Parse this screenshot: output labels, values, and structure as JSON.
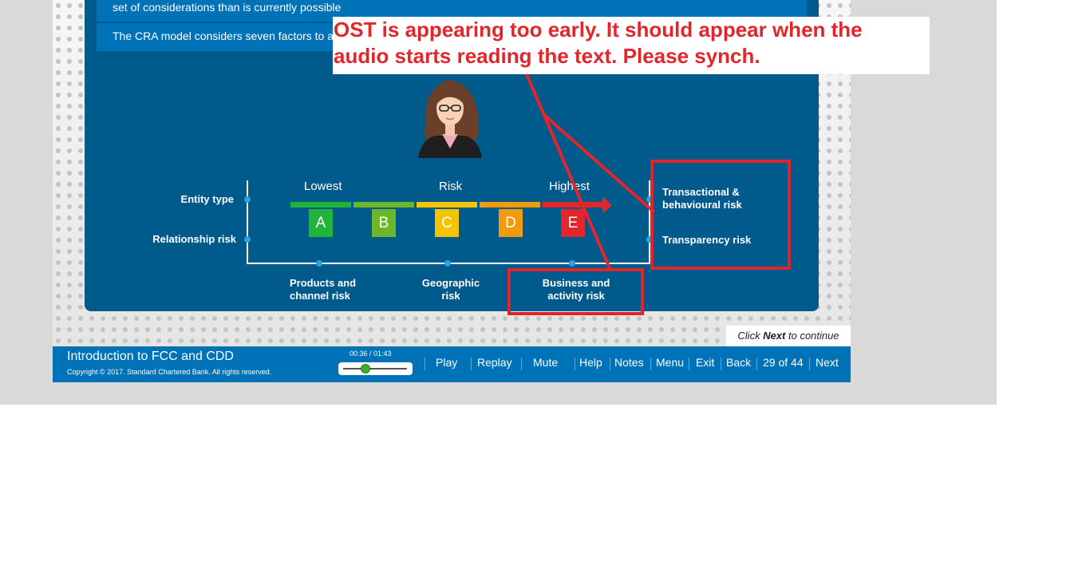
{
  "content": {
    "row1_text": "set of considerations than is currently possible",
    "row2_text": "The CRA model considers seven factors to a",
    "scale": {
      "lowest": "Lowest",
      "risk": "Risk",
      "highest": "Highest"
    },
    "levels": [
      {
        "letter": "A",
        "color": "#21b43a"
      },
      {
        "letter": "B",
        "color": "#6cb62a"
      },
      {
        "letter": "C",
        "color": "#f4c400"
      },
      {
        "letter": "D",
        "color": "#f39a0c"
      },
      {
        "letter": "E",
        "color": "#e2262c"
      }
    ],
    "factors": {
      "entity_type": "Entity type",
      "relationship_risk": "Relationship risk",
      "products_line1": "Products and",
      "products_line2": "channel risk",
      "geographic_line1": "Geographic",
      "geographic_line2": "risk",
      "business_line1": "Business and",
      "business_line2": "activity risk",
      "transactional_line1": "Transactional &",
      "transactional_line2": "behavioural risk",
      "transparency": "Transparency risk"
    }
  },
  "cta": {
    "prefix": "Click ",
    "strong": "Next",
    "suffix": " to continue"
  },
  "footer": {
    "course_title": "Introduction to FCC and CDD",
    "copyright": "Copyright © 2017. Standard Chartered Bank. All rights reserved.",
    "time": "00:36 / 01:43",
    "progress_fraction": 0.35,
    "nav": {
      "play": "Play",
      "replay": "Replay",
      "mute": "Mute",
      "help": "Help",
      "notes": "Notes",
      "menu": "Menu",
      "exit": "Exit",
      "back": "Back",
      "page": "29 of 44",
      "next": "Next"
    }
  },
  "annotation": {
    "line1": "OST is appearing too early. It should appear when the",
    "line2": "audio starts reading the text. Please synch.",
    "color": "#e2262c"
  }
}
